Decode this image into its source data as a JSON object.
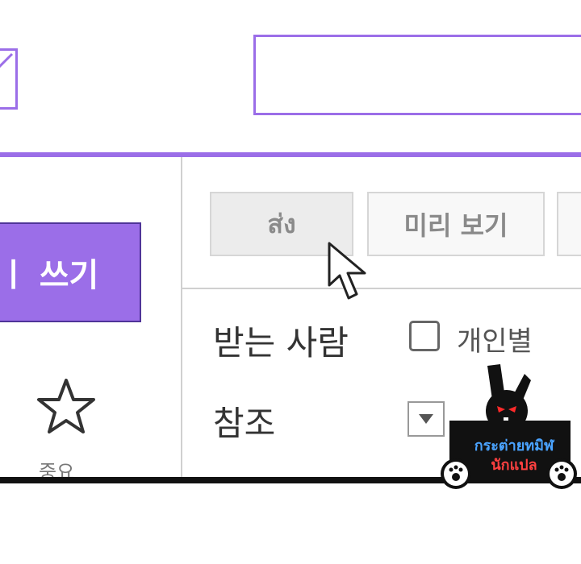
{
  "colors": {
    "accent": "#9b6ee8",
    "accent_border": "#4f3498",
    "divider": "#d0d0d0"
  },
  "sidebar": {
    "compose_label": "ㅣ 쓰기",
    "important_icon": "star-icon",
    "important_label": "중요"
  },
  "toolbar": {
    "send_label": "ส่ง",
    "preview_label": "미리 보기"
  },
  "compose": {
    "to_label": "받는 사람",
    "individual_label": "개인별",
    "cc_label": "참조",
    "individual_checked": false
  },
  "watermark": {
    "line1": "กระต่ายทมิฬ",
    "line2": "นักแปล"
  }
}
